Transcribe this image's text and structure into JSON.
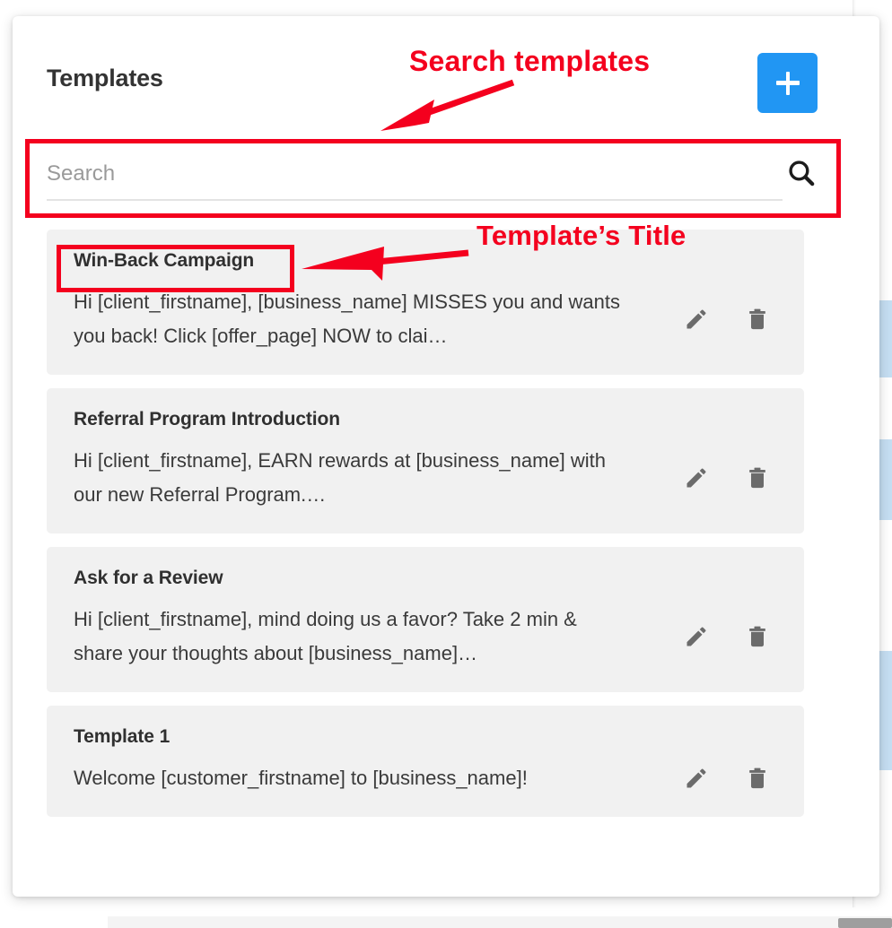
{
  "header": {
    "title": "Templates",
    "add_button_label": "+",
    "add_button_icon": "plus-icon",
    "add_button_color": "#2196f3"
  },
  "search": {
    "placeholder": "Search",
    "value": "",
    "icon": "search-icon"
  },
  "templates": [
    {
      "title": "Win-Back Campaign",
      "body": "Hi [client_firstname], [business_name] MISSES you and wants you back! Click [offer_page] NOW to clai…",
      "edit_icon": "pencil-icon",
      "delete_icon": "trash-icon"
    },
    {
      "title": "Referral Program Introduction",
      "body": "Hi [client_firstname], EARN rewards at [business_name] with our new Referral Program.…",
      "edit_icon": "pencil-icon",
      "delete_icon": "trash-icon"
    },
    {
      "title": "Ask for a Review",
      "body": "Hi [client_firstname], mind doing us a favor? Take 2 min & share your thoughts about [business_name]…",
      "edit_icon": "pencil-icon",
      "delete_icon": "trash-icon"
    },
    {
      "title": "Template 1",
      "body": "Welcome [customer_firstname] to [business_name]!",
      "edit_icon": "pencil-icon",
      "delete_icon": "trash-icon"
    }
  ],
  "annotations": {
    "color": "#f4001e",
    "search_label": "Search templates",
    "title_label": "Template’s Title"
  }
}
